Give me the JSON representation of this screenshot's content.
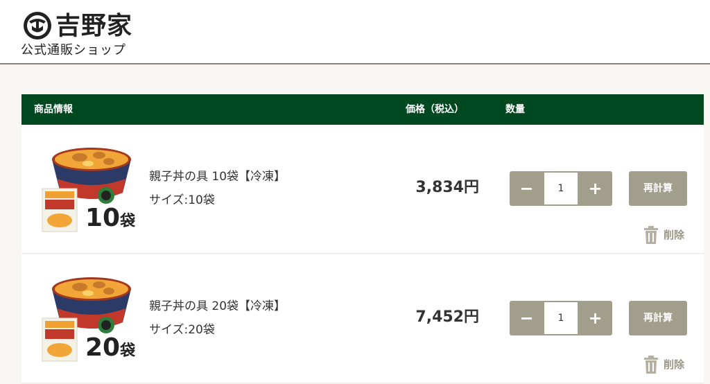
{
  "brand": {
    "name": "吉野家",
    "subtitle": "公式通販ショップ",
    "logo_icon": "yoshinoya-logo-icon"
  },
  "table": {
    "headers": {
      "info": "商品情報",
      "price": "価格（税込）",
      "quantity": "数量"
    }
  },
  "items": [
    {
      "image_count": "10",
      "image_unit": "袋",
      "name": "親子丼の具 10袋【冷凍】",
      "size": "サイズ:10袋",
      "price": "3,834円",
      "quantity": "1",
      "minus_label": "−",
      "plus_label": "+",
      "recalc_label": "再計算",
      "delete_label": "削除"
    },
    {
      "image_count": "20",
      "image_unit": "袋",
      "name": "親子丼の具 20袋【冷凍】",
      "size": "サイズ:20袋",
      "price": "7,452円",
      "quantity": "1",
      "minus_label": "−",
      "plus_label": "+",
      "recalc_label": "再計算",
      "delete_label": "削除"
    }
  ],
  "colors": {
    "header_green": "#00481f",
    "button_gray": "#a29e8c",
    "page_background": "#f7f6f2"
  }
}
